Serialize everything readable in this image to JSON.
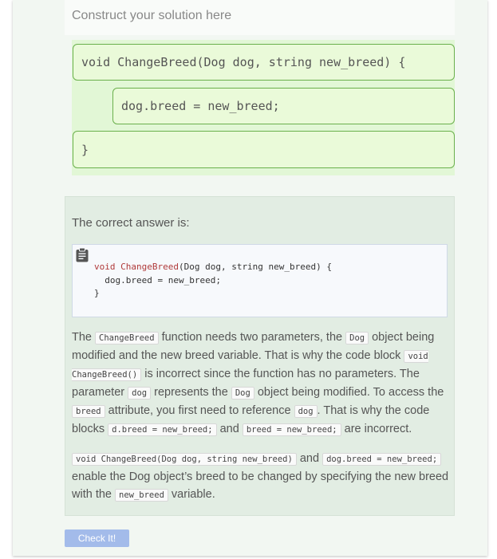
{
  "construct": {
    "header": "Construct your solution here",
    "blocks": [
      "void ChangeBreed(Dog dog, string new_breed) {",
      "dog.breed = new_breed;",
      "}"
    ]
  },
  "answer": {
    "intro": "The correct answer is:",
    "code": {
      "line1_kw": "void ChangeBreed",
      "line1_rest": "(Dog dog, string new_breed) {",
      "line2": "  dog.breed = new_breed;",
      "line3": "}"
    },
    "explanation": {
      "p1": {
        "t1": "The ",
        "c1": "ChangeBreed",
        "t2": " function needs two parameters, the ",
        "c2": "Dog",
        "t3": " object being modified and the new breed variable. That is why the code block ",
        "c3": "void ChangeBreed()",
        "t4": " is incorrect since the function has no parameters. The parameter ",
        "c4": "dog",
        "t5": " represents the ",
        "c5": "Dog",
        "t6": " object being modified. To access the ",
        "c6": "breed",
        "t7": " attribute, you first need to reference ",
        "c7": "dog",
        "t8": ". That is why the code blocks ",
        "c8": "d.breed = new_breed;",
        "t9": " and ",
        "c9": "breed = new_breed;",
        "t10": " are incorrect."
      },
      "p2": {
        "c1": "void ChangeBreed(Dog dog, string new_breed)",
        "t1": " and ",
        "c2": "dog.breed = new_breed;",
        "t2": " enable the Dog object’s breed to be changed by specifying the new breed with the ",
        "c3": "new_breed",
        "t3": " variable."
      }
    }
  },
  "check_button": "Check It!",
  "icons": {
    "clipboard": "clipboard-icon"
  },
  "colors": {
    "block_border": "#6ab04c",
    "block_bg": "#eafad9",
    "button_bg": "#a3bbea",
    "keyword": "#b03a3a"
  }
}
